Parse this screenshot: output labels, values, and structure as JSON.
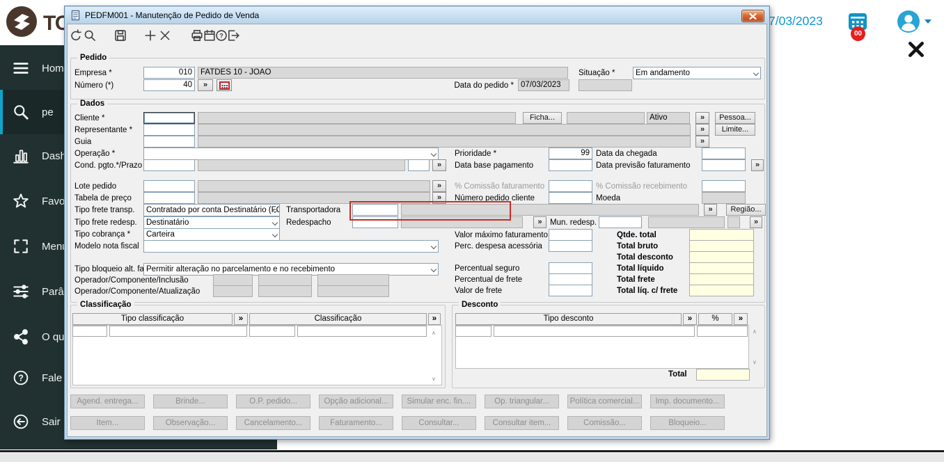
{
  "glyphs": {
    "expand": "»",
    "scroll_up": "∧",
    "scroll_down": "∨"
  },
  "topbar": {
    "logo_text": "TO",
    "date": "7/03/2023",
    "calendar_badge": "00"
  },
  "sidebar": {
    "items": [
      {
        "label": "Hom",
        "icon": "hamburger-icon"
      },
      {
        "label": "pe",
        "icon": "search-icon",
        "active": true
      },
      {
        "label": "Dash",
        "icon": "bar-chart-icon"
      },
      {
        "label": "Favo",
        "icon": "star-icon"
      },
      {
        "label": "Menu",
        "icon": "menu-grid-icon"
      },
      {
        "label": "Parâ",
        "icon": "sliders-icon"
      },
      {
        "label": "O qu",
        "icon": "share-icon"
      },
      {
        "label": "Fale",
        "icon": "help-circle-icon"
      },
      {
        "label": "Sair",
        "icon": "logout-icon"
      }
    ]
  },
  "dialog": {
    "title": "PEDFM001 - Manutenção de Pedido de Venda",
    "pedido": {
      "legend": "Pedido",
      "empresa_label": "Empresa *",
      "empresa_code": "010",
      "empresa_desc": "FATDES 10 - JOAO",
      "numero_label": "Número (*)",
      "numero_value": "40",
      "data_pedido_label": "Data do pedido *",
      "data_pedido_value": "07/03/2023",
      "situacao_label": "Situação *",
      "situacao_value": "Em andamento"
    },
    "dados": {
      "legend": "Dados",
      "cliente_label": "Cliente *",
      "ficha_button": "Ficha...",
      "ativo_value": "Ativo",
      "pessoa_button": "Pessoa...",
      "representante_label": "Representante *",
      "limite_button": "Limite...",
      "guia_label": "Guia",
      "operacao_label": "Operação *",
      "prioridade_label": "Prioridade *",
      "prioridade_value": "99",
      "data_chegada_label": "Data da chegada",
      "cond_pgto_label": "Cond. pgto.*/Prazo",
      "data_base_label": "Data base pagamento",
      "data_previsao_label": "Data previsão faturamento",
      "lote_label": "Lote pedido",
      "comissao_fat_label": "% Comissão faturamento",
      "comissao_rec_label": "% Comissão recebimento",
      "tabela_label": "Tabela de preço",
      "num_pedido_cliente_label": "Número pedido cliente",
      "moeda_label": "Moeda",
      "frete_transp_label": "Tipo frete transp.",
      "frete_transp_value": "Contratado por conta Destinatário (FC",
      "transportadora_label": "Transportadora",
      "regiao_button": "Região...",
      "frete_redesp_label": "Tipo frete redesp.",
      "frete_redesp_value": "Destinatário",
      "redespacho_label": "Redespacho",
      "mun_redesp_label": "Mun. redesp.",
      "cobranca_label": "Tipo cobrança *",
      "cobranca_value": "Carteira",
      "valor_max_label": "Valor máximo faturamento",
      "modelo_nf_label": "Modelo nota fiscal",
      "perc_despesa_label": "Perc. despesa acessória",
      "bloqueio_label": "Tipo bloqueio alt. fat.",
      "bloqueio_value": "Permitir alteração no parcelamento e no recebimento",
      "perc_seguro_label": "Percentual seguro",
      "oper_inclusao_label": "Operador/Componente/Inclusão",
      "perc_frete_label": "Percentual de frete",
      "oper_atualizacao_label": "Operador/Componente/Atualização",
      "valor_frete_label": "Valor de frete",
      "totals": [
        {
          "label": "Qtde. total"
        },
        {
          "label": "Total bruto"
        },
        {
          "label": "Total desconto"
        },
        {
          "label": "Total líquido"
        },
        {
          "label": "Total frete"
        },
        {
          "label": "Total líq. c/ frete"
        }
      ]
    },
    "classificacao": {
      "legend": "Classificação",
      "col_tipo": "Tipo classificação",
      "col_class": "Classificação"
    },
    "desconto": {
      "legend": "Desconto",
      "col_tipo": "Tipo desconto",
      "col_pct": "%",
      "total_label": "Total"
    },
    "actions_row1": [
      "Agend. entrega...",
      "Brinde...",
      "O.P. pedido...",
      "Opção adicional...",
      "Simular enc. fin....",
      "Op. triangular...",
      "Política comercial...",
      "Imp. documento..."
    ],
    "actions_row2": [
      "Item...",
      "Observação...",
      "Cancelamento...",
      "Faturamento...",
      "Consultar...",
      "Consultar item...",
      "Comissão...",
      "Bloqueio..."
    ]
  }
}
